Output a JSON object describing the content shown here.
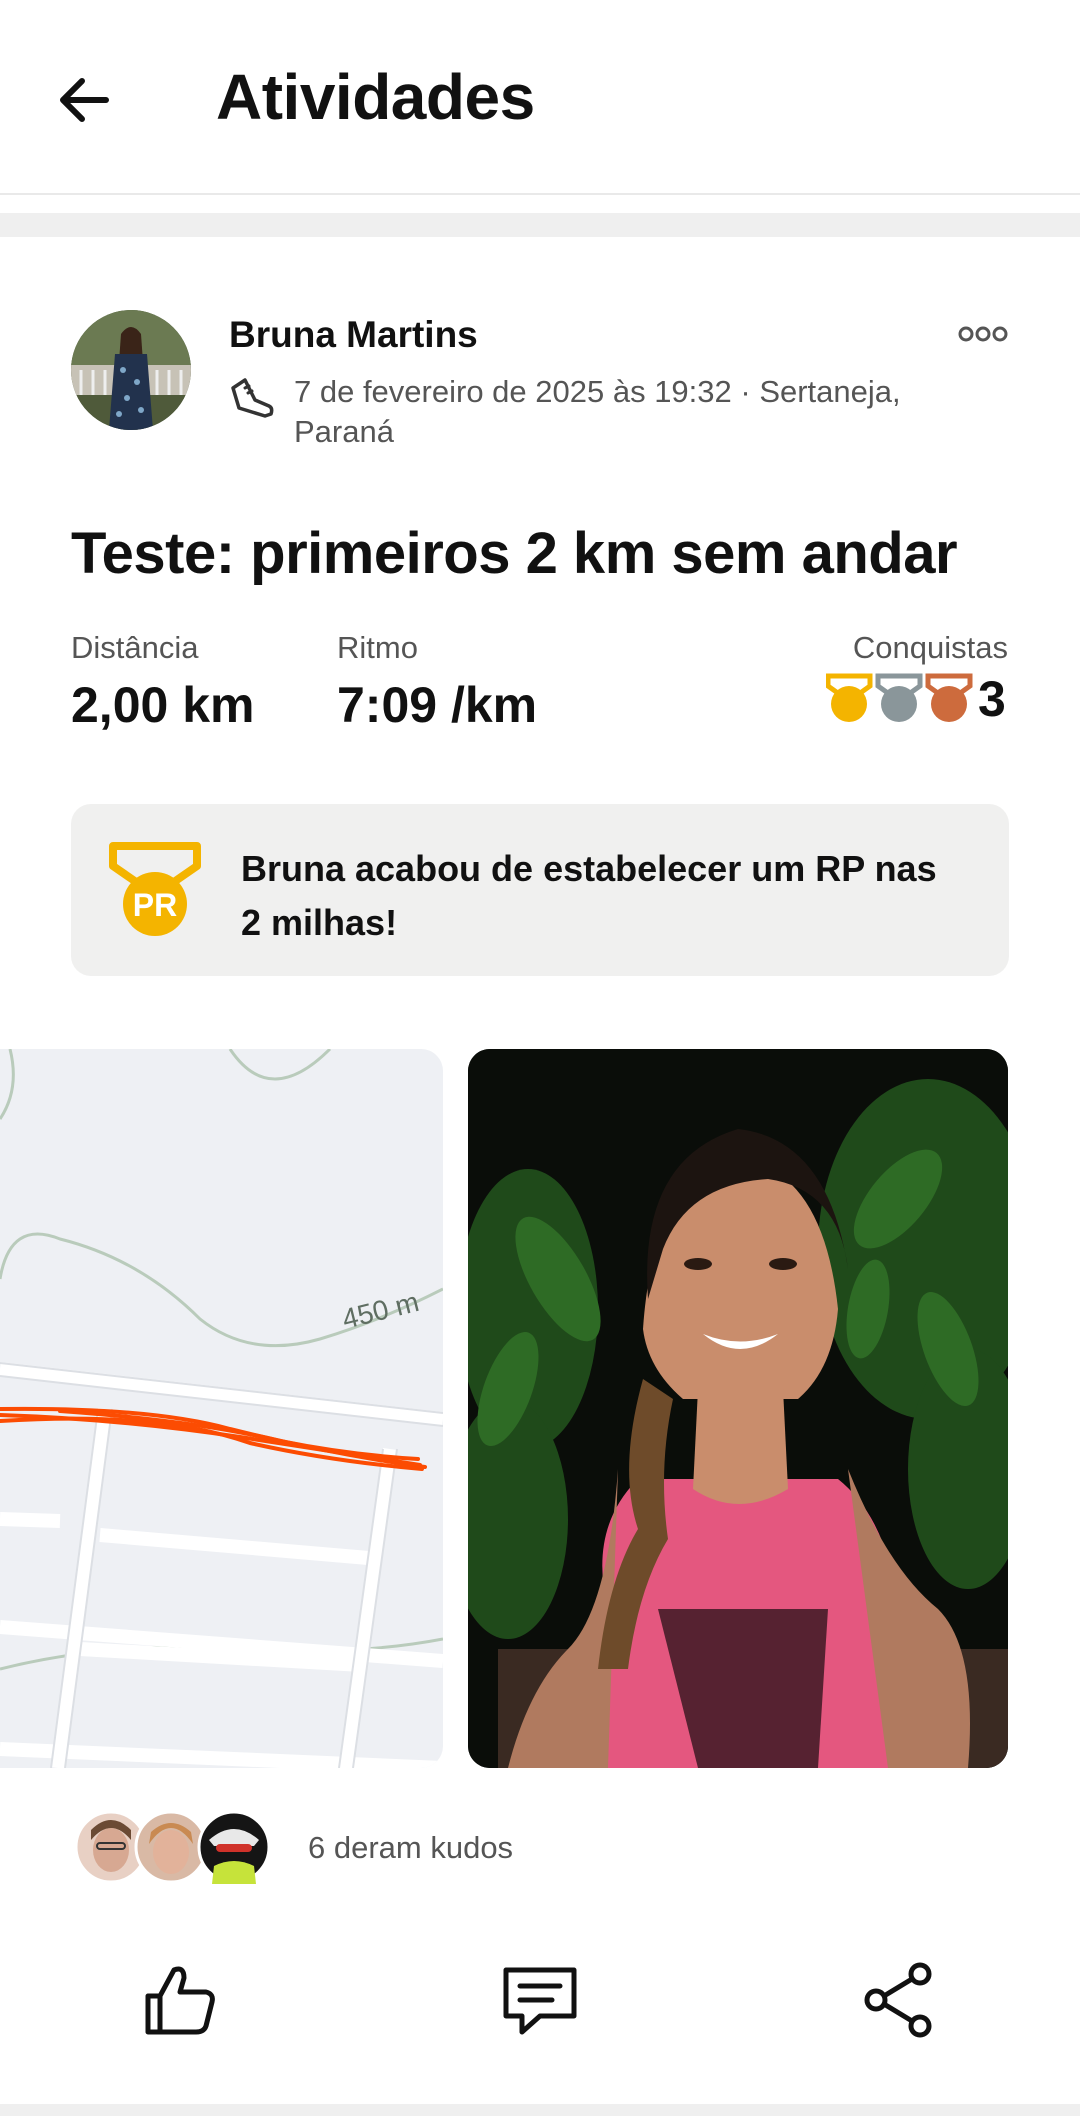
{
  "header": {
    "title": "Atividades",
    "back_icon": "arrow-left-icon"
  },
  "post": {
    "athlete_name": "Bruna Martins",
    "activity_icon": "running-shoe-icon",
    "meta": "7 de fevereiro de 2025 às 19:32 · Sertaneja, Paraná",
    "more_icon": "more-options-icon",
    "title": "Teste: primeiros 2 km sem andar",
    "stats": {
      "distance_label": "Distância",
      "distance_value": "2,00 km",
      "pace_label": "Ritmo",
      "pace_value": "7:09 /km",
      "achievements_label": "Conquistas",
      "achievements_count": "3"
    },
    "achievement_banner": {
      "badge_text": "PR",
      "text": "Bruna acabou de estabelecer um RP nas 2 milhas!"
    },
    "map": {
      "elevation_label": "450 m",
      "route_color": "#fc4c02"
    },
    "kudos_text": "6 deram kudos"
  },
  "actions": [
    "kudos-thumb-icon",
    "comment-icon",
    "share-icon"
  ],
  "colors": {
    "accent": "#fc4c02",
    "gold": "#f4b400",
    "silver": "#8a969a",
    "bronze": "#cd6b3d"
  }
}
